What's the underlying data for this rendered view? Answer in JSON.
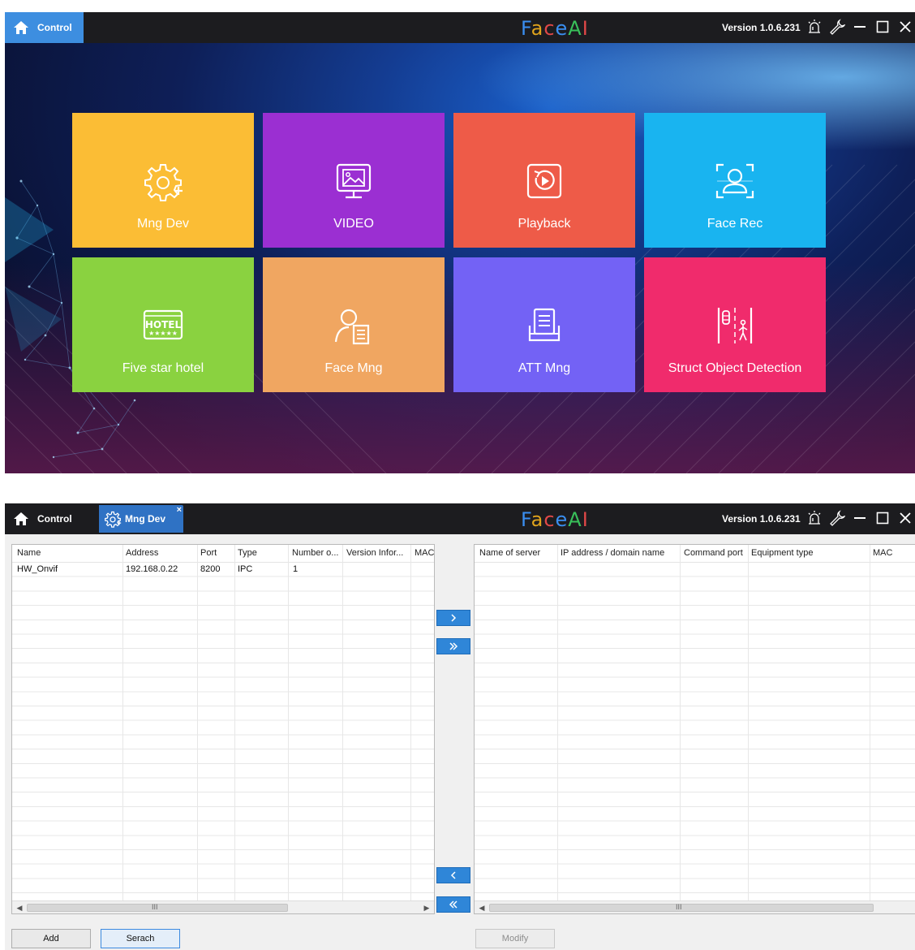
{
  "top_window": {
    "home_tab": "Control",
    "brand": [
      "F",
      "a",
      "c",
      "e",
      "A",
      "I"
    ],
    "version": "Version 1.0.6.231",
    "tiles": [
      {
        "label": "Mng Dev",
        "color": "#fbbd35",
        "icon": "gear-plus-icon"
      },
      {
        "label": "VIDEO",
        "color": "#9b2fd2",
        "icon": "monitor-image-icon"
      },
      {
        "label": "Playback",
        "color": "#ee5b48",
        "icon": "playback-icon"
      },
      {
        "label": "Face Rec",
        "color": "#19b4f0",
        "icon": "face-scan-icon"
      },
      {
        "label": "Five star hotel",
        "color": "#8ad240",
        "icon": "hotel-sign-icon"
      },
      {
        "label": "Face Mng",
        "color": "#f0a661",
        "icon": "person-document-icon"
      },
      {
        "label": "ATT Mng",
        "color": "#7362f5",
        "icon": "attendance-printer-icon"
      },
      {
        "label": "Struct Object Detection",
        "color": "#f02b6c",
        "icon": "object-detection-icon"
      }
    ]
  },
  "bottom_window": {
    "home_tab": "Control",
    "active_tab": "Mng Dev",
    "tab_close": "×",
    "brand": [
      "F",
      "a",
      "c",
      "e",
      "A",
      "I"
    ],
    "version": "Version 1.0.6.231",
    "left_grid": {
      "columns": [
        "Name",
        "Address",
        "Port",
        "Type",
        "Number o...",
        "Version Infor...",
        "MAC"
      ],
      "rows": [
        [
          "HW_Onvif",
          "192.168.0.22",
          "8200",
          "IPC",
          "1",
          "",
          ""
        ]
      ]
    },
    "right_grid": {
      "columns": [
        "Name of server",
        "IP address / domain name",
        "Command port",
        "Equipment type",
        "MAC"
      ],
      "rows": []
    },
    "scroll_grip": "III",
    "buttons": {
      "add": "Add",
      "search": "Serach",
      "modify": "Modify"
    }
  }
}
